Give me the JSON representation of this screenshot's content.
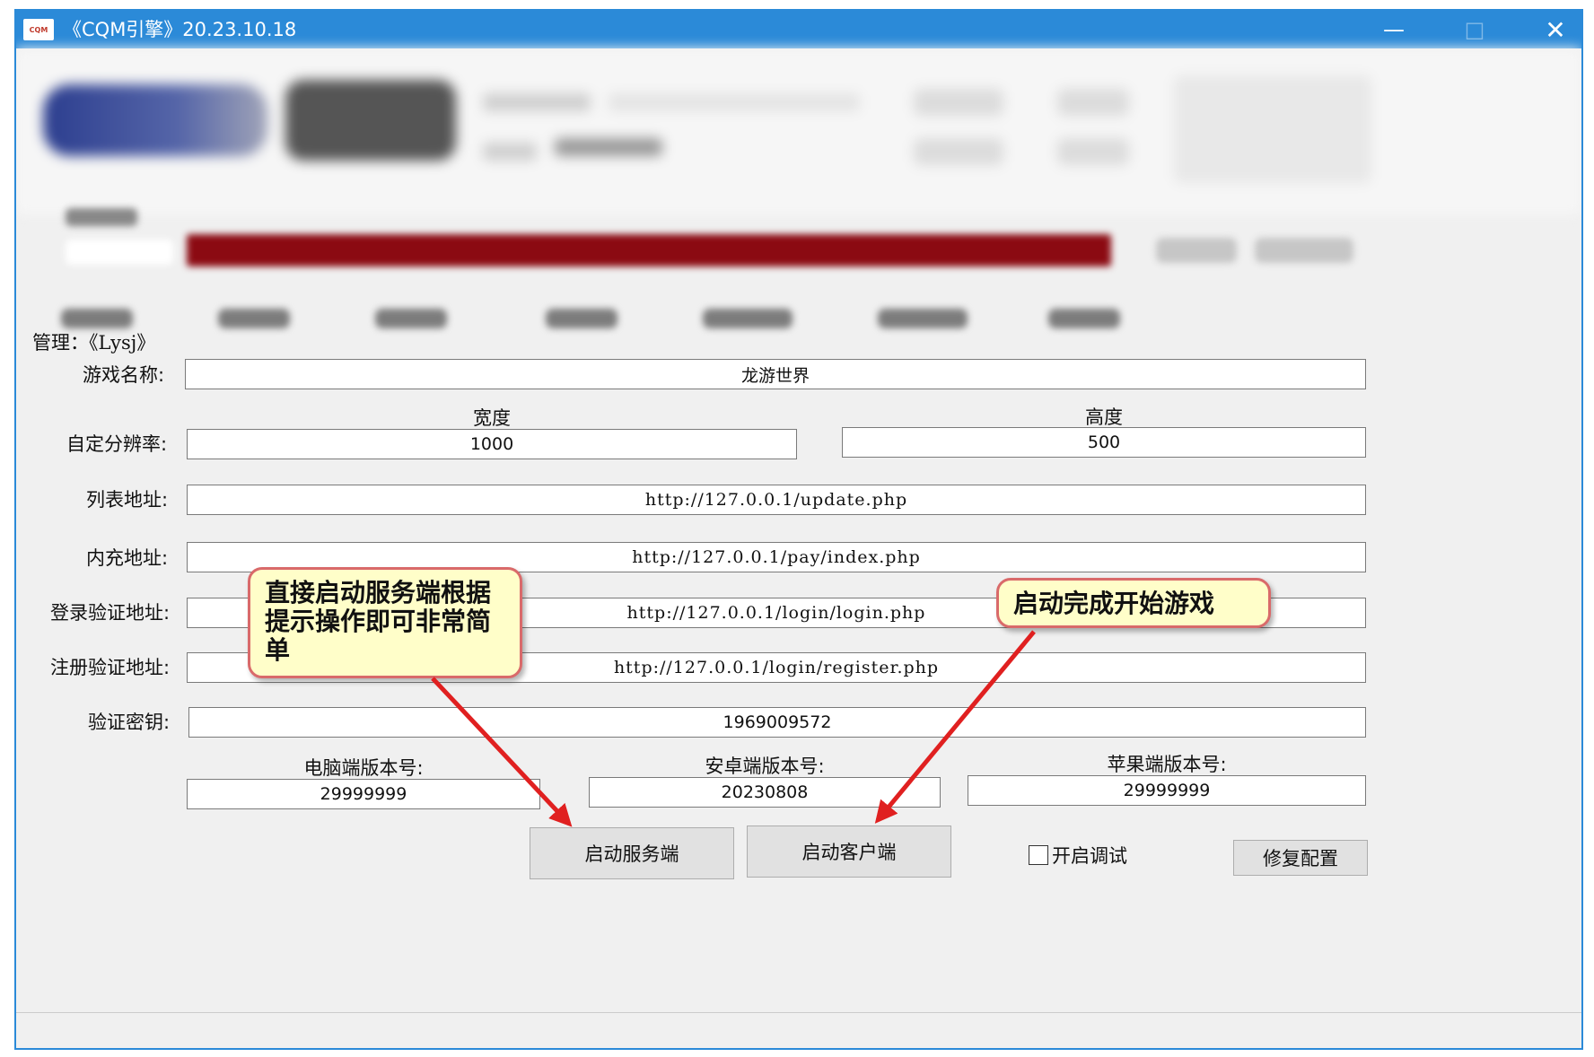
{
  "window": {
    "icon_text": "CQM",
    "title": "《CQM引擎》20.23.10.18",
    "min_glyph": "—",
    "max_glyph": "□",
    "close_glyph": "✕"
  },
  "manager": {
    "label": "管理：《Lysj》"
  },
  "form": {
    "game_name": {
      "label": "游戏名称:",
      "value": "龙游世界"
    },
    "resolution": {
      "label": "自定分辨率:",
      "width_header": "宽度",
      "height_header": "高度",
      "width_value": "1000",
      "height_value": "500"
    },
    "list_url": {
      "label": "列表地址:",
      "value": "http://127.0.0.1/update.php"
    },
    "pay_url": {
      "label": "内充地址:",
      "value": "http://127.0.0.1/pay/index.php"
    },
    "login_url": {
      "label": "登录验证地址:",
      "value": "http://127.0.0.1/login/login.php"
    },
    "register_url": {
      "label": "注册验证地址:",
      "value": "http://127.0.0.1/login/register.php"
    },
    "verify_key": {
      "label": "验证密钥:",
      "value": "1969009572"
    },
    "versions": {
      "pc_label": "电脑端版本号:",
      "pc_value": "29999999",
      "android_label": "安卓端版本号:",
      "android_value": "20230808",
      "ios_label": "苹果端版本号:",
      "ios_value": "29999999"
    }
  },
  "actions": {
    "start_server": "启动服务端",
    "start_client": "启动客户端",
    "debug_label": "开启调试",
    "debug_checked": false,
    "repair_config": "修复配置"
  },
  "annotations": {
    "callout_left": "直接启动服务端根据提示操作即可非常简单",
    "callout_right": "启动完成开始游戏",
    "arrow_color": "#e02020"
  },
  "colors": {
    "titlebar": "#2b8ad8",
    "callout_bg": "#fffec9",
    "callout_border": "#d96a6a",
    "progress_red": "#8b0a12"
  }
}
